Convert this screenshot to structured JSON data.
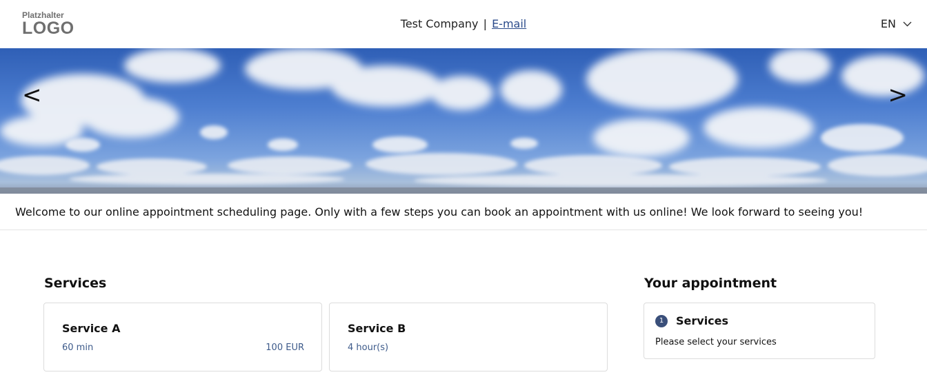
{
  "header": {
    "logo_small": "Platzhalter",
    "logo_big": "LOGO",
    "company": "Test Company",
    "separator": "|",
    "email_link": "E-mail",
    "language": "EN"
  },
  "banner": {
    "prev_label": "<",
    "next_label": ">"
  },
  "welcome_text": "Welcome to our online appointment scheduling page. Only with a few steps you can book an appointment with us online! We look forward to seeing you!",
  "services": {
    "title": "Services",
    "items": [
      {
        "name": "Service A",
        "duration": "60 min",
        "price": "100 EUR"
      },
      {
        "name": "Service B",
        "duration": "4 hour(s)",
        "price": ""
      }
    ]
  },
  "appointment": {
    "title": "Your appointment",
    "step_number": "1",
    "step_title": "Services",
    "step_hint": "Please select your services"
  },
  "colors": {
    "accent": "#3a4f7a",
    "link": "#2a4a8a",
    "muted_text": "#3d5a8a",
    "border": "#dcdcdc"
  },
  "icons": {
    "language_toggle": "chevron-down-icon",
    "banner_prev": "chevron-left-icon",
    "banner_next": "chevron-right-icon"
  }
}
